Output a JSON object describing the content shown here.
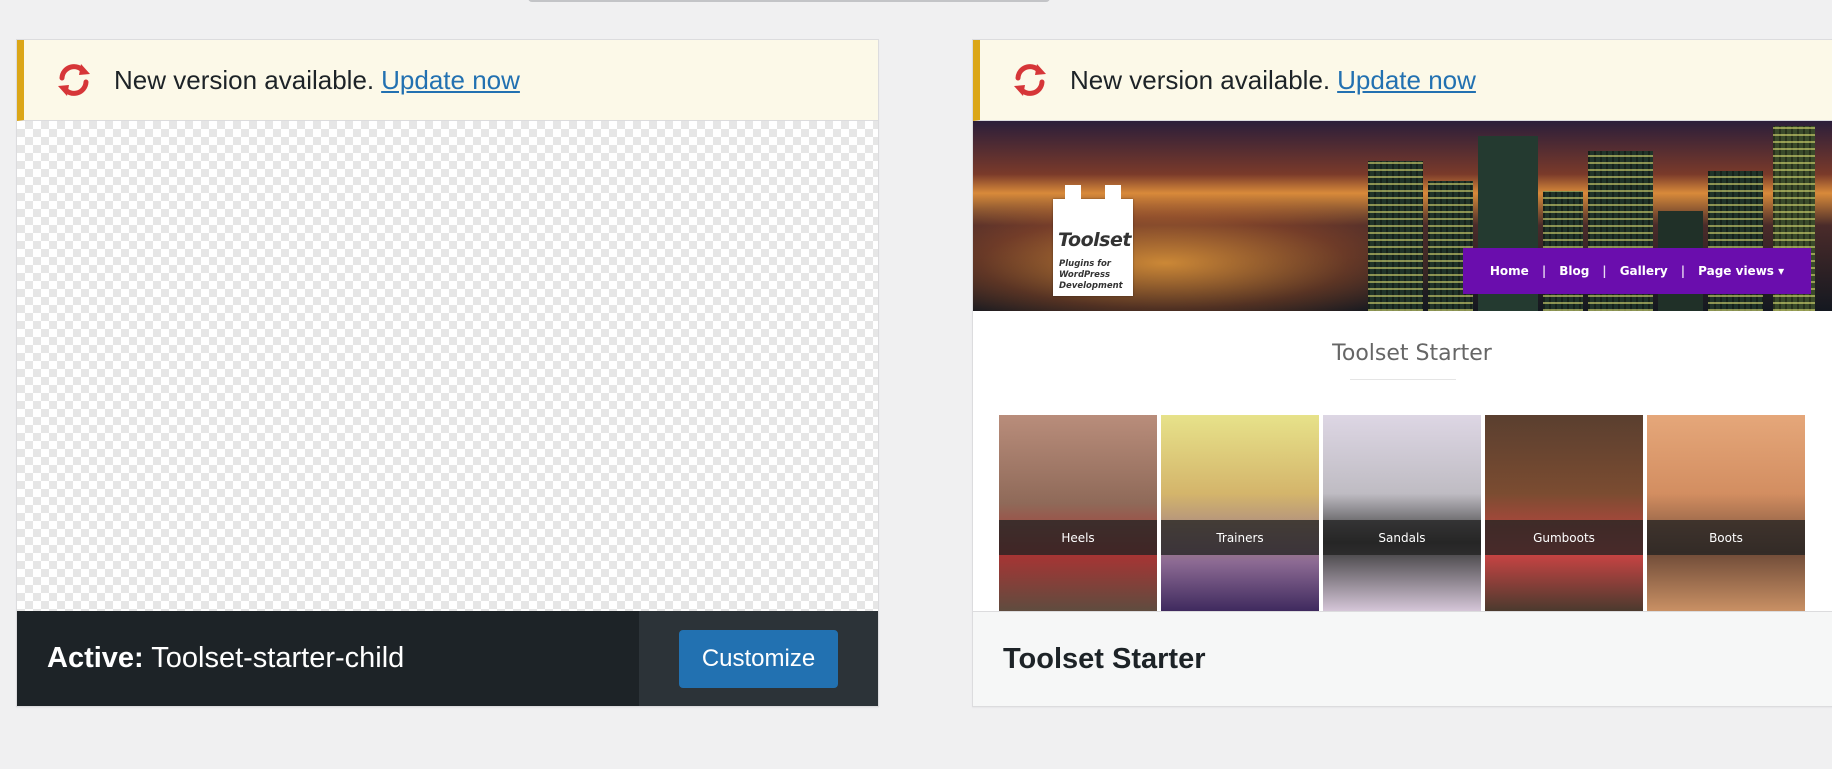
{
  "themes": [
    {
      "notice": {
        "text": "New version available.",
        "link": "Update now"
      },
      "active_prefix": "Active:",
      "name": "Toolset-starter-child",
      "action": "Customize"
    },
    {
      "notice": {
        "text": "New version available.",
        "link": "Update now"
      },
      "name": "Toolset Starter",
      "preview": {
        "logo": "Toolset",
        "tagline": [
          "Plugins for",
          "WordPress",
          "Development"
        ],
        "nav": [
          "Home",
          "Blog",
          "Gallery",
          "Page views ▾"
        ],
        "site_title": "Toolset Starter",
        "categories": [
          "Heels",
          "Trainers",
          "Sandals",
          "Gumboots",
          "Boots"
        ]
      }
    }
  ],
  "colors": {
    "notice_bg": "#fcf9e8",
    "notice_accent": "#dba617",
    "link": "#2271b1",
    "update_icon": "#d63638",
    "nav_purple": "#6a0dad"
  },
  "icons": {
    "update": "update-arrows-icon"
  }
}
